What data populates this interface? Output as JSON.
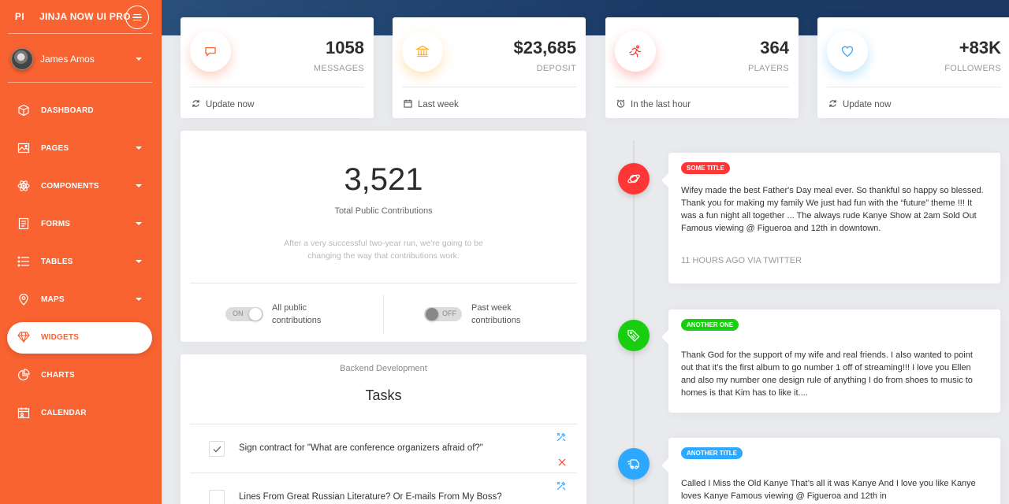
{
  "brand": {
    "mini": "PI",
    "name": "JINJA NOW UI PRO"
  },
  "user": {
    "name": "James Amos"
  },
  "nav": [
    {
      "label": "DASHBOARD",
      "icon": "cube-icon",
      "caret": false,
      "active": false
    },
    {
      "label": "PAGES",
      "icon": "image-icon",
      "caret": true,
      "active": false
    },
    {
      "label": "COMPONENTS",
      "icon": "atom-icon",
      "caret": true,
      "active": false
    },
    {
      "label": "FORMS",
      "icon": "paper-icon",
      "caret": true,
      "active": false
    },
    {
      "label": "TABLES",
      "icon": "list-icon",
      "caret": true,
      "active": false
    },
    {
      "label": "MAPS",
      "icon": "pin-icon",
      "caret": true,
      "active": false
    },
    {
      "label": "WIDGETS",
      "icon": "diamond-icon",
      "caret": false,
      "active": true
    },
    {
      "label": "CHARTS",
      "icon": "pie-chart-icon",
      "caret": false,
      "active": false
    },
    {
      "label": "CALENDAR",
      "icon": "calendar-icon",
      "caret": false,
      "active": false
    }
  ],
  "stats": [
    {
      "value": "1058",
      "label": "MESSAGES",
      "footer": "Update now",
      "icon": "chat-icon",
      "footer_icon": "refresh-icon",
      "color": "#f96332"
    },
    {
      "value": "$23,685",
      "label": "DEPOSIT",
      "footer": "Last week",
      "icon": "bank-icon",
      "footer_icon": "calendar-icon",
      "color": "#ffb236"
    },
    {
      "value": "364",
      "label": "PLAYERS",
      "footer": "In the last hour",
      "icon": "runner-icon",
      "footer_icon": "alarm-clock-icon",
      "color": "#ff3636"
    },
    {
      "value": "+83K",
      "label": "FOLLOWERS",
      "footer": "Update now",
      "icon": "heart-icon",
      "footer_icon": "refresh-icon",
      "color": "#2ca8ff"
    }
  ],
  "contributions": {
    "value": "3,521",
    "label": "Total Public Contributions",
    "description": "After a very successful two-year run, we’re going to be changing the way that contributions work.",
    "switch_left": {
      "state": "ON",
      "label_line1": "All public",
      "label_line2": "contributions"
    },
    "switch_right": {
      "state": "OFF",
      "label_line1": "Past week",
      "label_line2": "contributions"
    }
  },
  "tasks": {
    "category": "Backend Development",
    "title": "Tasks",
    "items": [
      {
        "text": "Sign contract for \"What are conference organizers afraid of?\"",
        "checked": true
      },
      {
        "text": "Lines From Great Russian Literature? Or E-mails From My Boss?",
        "checked": false
      }
    ]
  },
  "timeline": [
    {
      "tag": "SOME TITLE",
      "tag_color": "#ff3636",
      "badge_icon": "planet-icon",
      "text": "Wifey made the best Father's Day meal ever. So thankful so happy so blessed. Thank you for making my family We just had fun with the “future” theme !!! It was a fun night all together ... The always rude Kanye Show at 2am Sold Out Famous viewing @ Figueroa and 12th in downtown.",
      "footer": "11 HOURS AGO VIA TWITTER"
    },
    {
      "tag": "ANOTHER ONE",
      "tag_color": "#18ce0f",
      "badge_icon": "tag-icon",
      "text": "Thank God for the support of my wife and real friends. I also wanted to point out that it’s the first album to go number 1 off of streaming!!! I love you Ellen and also my number one design rule of anything I do from shoes to music to homes is that Kim has to like it....",
      "footer": ""
    },
    {
      "tag": "ANOTHER TITLE",
      "tag_color": "#2ca8ff",
      "badge_icon": "delivery-icon",
      "text": "Called I Miss the Old Kanye That’s all it was Kanye And I love you like Kanye loves Kanye Famous viewing @ Figueroa and 12th in",
      "footer": ""
    }
  ]
}
